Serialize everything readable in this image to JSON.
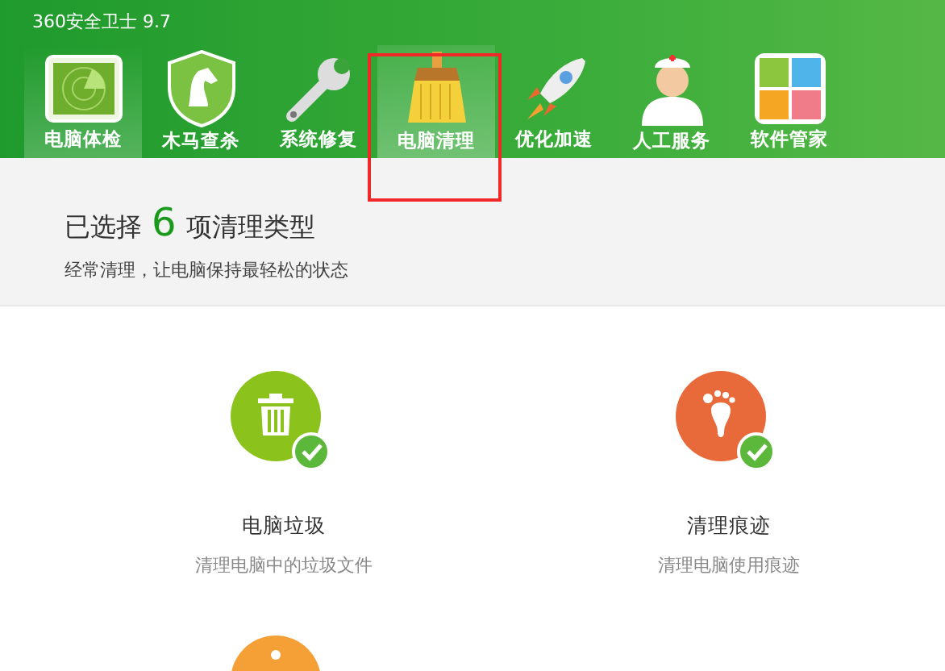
{
  "window": {
    "title": "360安全卫士 9.7"
  },
  "tabs": [
    {
      "label": "电脑体检",
      "selected": false,
      "highlighted": true,
      "annotated": false
    },
    {
      "label": "木马查杀",
      "selected": false,
      "highlighted": false,
      "annotated": false
    },
    {
      "label": "系统修复",
      "selected": false,
      "highlighted": false,
      "annotated": false
    },
    {
      "label": "电脑清理",
      "selected": true,
      "highlighted": false,
      "annotated": true
    },
    {
      "label": "优化加速",
      "selected": false,
      "highlighted": false,
      "annotated": false
    },
    {
      "label": "人工服务",
      "selected": false,
      "highlighted": false,
      "annotated": false
    },
    {
      "label": "软件管家",
      "selected": false,
      "highlighted": false,
      "annotated": false
    }
  ],
  "summary": {
    "prefix": "已选择",
    "count": "6",
    "suffix": "项清理类型",
    "subtitle": "经常清理，让电脑保持最轻松的状态"
  },
  "items": [
    {
      "color": "#8cc21c",
      "checked": true,
      "name": "电脑垃圾",
      "description": "清理电脑中的垃圾文件"
    },
    {
      "color": "#e8693a",
      "checked": true,
      "name": "清理痕迹",
      "description": "清理电脑使用痕迹"
    },
    {
      "color": "#f4a037"
    }
  ]
}
